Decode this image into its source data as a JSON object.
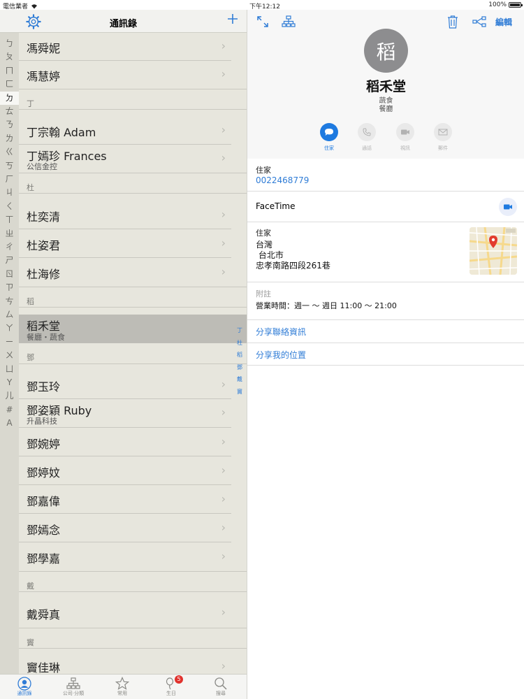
{
  "status": {
    "carrier": "電信業者",
    "time": "下午12:12",
    "battery": "100%"
  },
  "left_nav": {
    "title": "通訊錄"
  },
  "index_bar": [
    "ㄅ",
    "ㄆ",
    "ㄇ",
    "ㄈ",
    "ㄉ",
    "ㄊ",
    "ㄋ",
    "ㄌ",
    "ㄍ",
    "ㄎ",
    "ㄏ",
    "ㄐ",
    "ㄑ",
    "ㄒ",
    "ㄓ",
    "ㄔ",
    "ㄕ",
    "ㄖ",
    "ㄗ",
    "ㄘ",
    "ㄙ",
    "ㄚ",
    "ㄧ",
    "ㄨ",
    "ㄩ",
    "Y",
    "儿",
    "#",
    "A"
  ],
  "contacts": {
    "r1": {
      "name": "馮舜妮"
    },
    "r2": {
      "name": "馮慧婷"
    },
    "h1": "丁",
    "r3": {
      "name": "丁宗翰 Adam"
    },
    "r4": {
      "name": "丁嫣珍 Frances",
      "sub": "公信金控"
    },
    "h2": "杜",
    "r5": {
      "name": "杜奕清"
    },
    "r6": {
      "name": "杜姿君"
    },
    "r7": {
      "name": "杜海修"
    },
    "h3": "稻",
    "r8": {
      "name": "稻禾堂",
      "sub": "餐廳・蔬食"
    },
    "h4": "鄧",
    "r9": {
      "name": "鄧玉玲"
    },
    "r10": {
      "name": "鄧姿穎 Ruby",
      "sub": "升晶科技"
    },
    "r11": {
      "name": "鄧婉婷"
    },
    "r12": {
      "name": "鄧婷妏"
    },
    "r13": {
      "name": "鄧嘉偉"
    },
    "r14": {
      "name": "鄧嫣念"
    },
    "r15": {
      "name": "鄧學嘉"
    },
    "h5": "戴",
    "r16": {
      "name": "戴舜真"
    },
    "h6": "竇",
    "r17": {
      "name": "竇佳琳"
    }
  },
  "section_index": [
    "丁",
    "杜",
    "稻",
    "鄧",
    "戴",
    "竇"
  ],
  "tabbar": {
    "contacts": "通訊錄",
    "company": "公司‧分類",
    "favorites": "常用",
    "birthday": "生日",
    "birthday_badge": "5",
    "search": "搜尋"
  },
  "detail": {
    "edit": "編輯",
    "avatar_char": "稻",
    "name": "稻禾堂",
    "sub1": "蔬食",
    "sub2": "餐廳",
    "actions": {
      "message": "住家",
      "call": "通話",
      "video": "視訊",
      "mail": "郵件"
    },
    "phone_label": "住家",
    "phone": "0022468779",
    "facetime": "FaceTime",
    "address_label": "住家",
    "address_line1": "台灣",
    "address_line2": " 台北市",
    "address_line3": "忠孝南路四段261巷",
    "notes_label": "附註",
    "notes": "營業時間：週一 ～ 週日 11:00 ～ 21:00",
    "share_contact": "分享聯絡資訊",
    "share_location": "分享我的位置"
  },
  "colors": {
    "accent": "#2f7cd6",
    "list_bg": "#e7e6dd",
    "selected_row": "#bdbcb6",
    "badge": "#e1322d"
  }
}
